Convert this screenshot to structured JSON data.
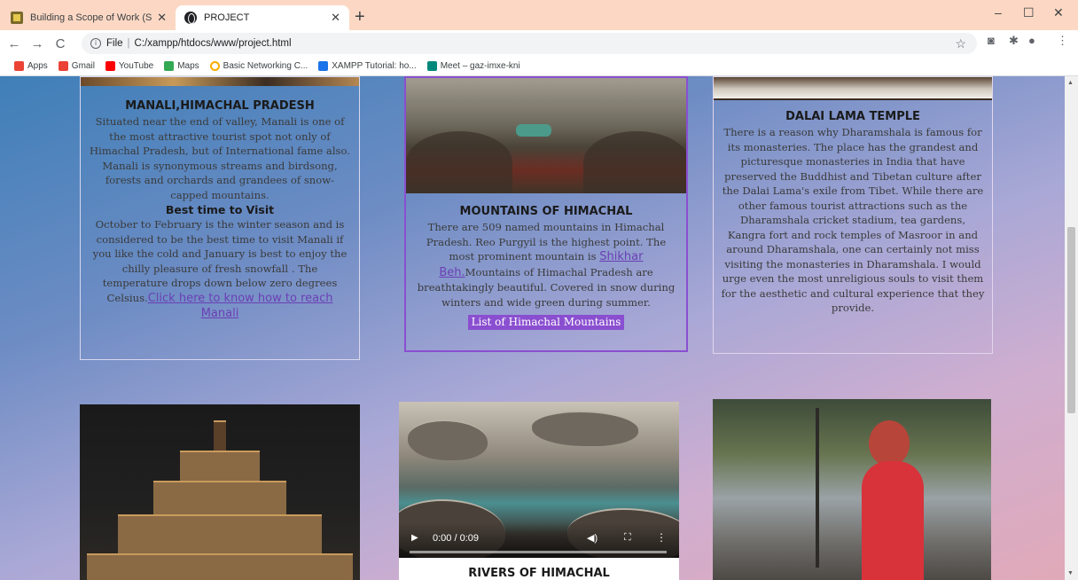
{
  "browser": {
    "tabs": [
      {
        "title": "Building a Scope of Work (SOW)",
        "active": false
      },
      {
        "title": "PROJECT",
        "active": true
      }
    ],
    "new_tab_label": "+",
    "url_scheme": "File",
    "url_path": "C:/xampp/htdocs/www/project.html",
    "bookmarks": [
      {
        "label": "Apps",
        "icon": "apps-grid-icon",
        "color": "#ea4335"
      },
      {
        "label": "Gmail",
        "icon": "gmail-icon",
        "color": "#ea4335"
      },
      {
        "label": "YouTube",
        "icon": "youtube-icon",
        "color": "#ff0000"
      },
      {
        "label": "Maps",
        "icon": "maps-icon",
        "color": "#34a853"
      },
      {
        "label": "Basic Networking C...",
        "icon": "circle-icon",
        "color": "#f9ab00"
      },
      {
        "label": "XAMPP Tutorial: ho...",
        "icon": "xampp-icon",
        "color": "#1a73e8"
      },
      {
        "label": "Meet – gaz-imxe-kni",
        "icon": "meet-icon",
        "color": "#00897b"
      }
    ]
  },
  "cards": {
    "manali": {
      "title": "MANALI,HIMACHAL PRADESH",
      "text": "Situated near the end of valley, Manali is one of the most attractive tourist spot not only of Himachal Pradesh, but of International fame also. Manali is synonymous streams and birdsong, forests and orchards and grandees of snow-capped mountains.",
      "subtitle": "Best time to Visit",
      "text2": "October to February is the winter season and is considered to be the best time to visit Manali if you like the cold and January is best to enjoy the chilly pleasure of fresh snowfall . The temperature drops down below zero degrees Celsius.",
      "link": "Click here to know how to reach Manali"
    },
    "mountains": {
      "title": "MOUNTAINS OF HIMACHAL",
      "text_before": "There are 509 named mountains in Himachal Pradesh. Reo Purgyil is the highest point. The most prominent mountain is ",
      "link": "Shikhar Beh.",
      "text_after": "Mountains of Himachal Pradesh are breathtakingly beautiful. Covered in snow during winters and wide green during summer.",
      "button": "List of Himachal Mountains"
    },
    "dalai": {
      "title": "DALAI LAMA TEMPLE",
      "text": "There is a reason why Dharamshala is famous for its monasteries. The place has the grandest and picturesque monasteries in India that have preserved the Buddhist and Tibetan culture after the Dalai Lama's exile from Tibet. While there are other famous tourist attractions such as the Dharamshala cricket stadium, tea gardens, Kangra fort and rock temples of Masroor in and around Dharamshala, one can certainly not miss visiting the monasteries in Dharamshala. I would urge even the most unreligious souls to visit them for the aesthetic and cultural experience that they provide."
    },
    "rivers": {
      "title": "RIVERS OF HIMACHAL",
      "video_time": "0:00 / 0:09",
      "video_progress": 0
    }
  }
}
